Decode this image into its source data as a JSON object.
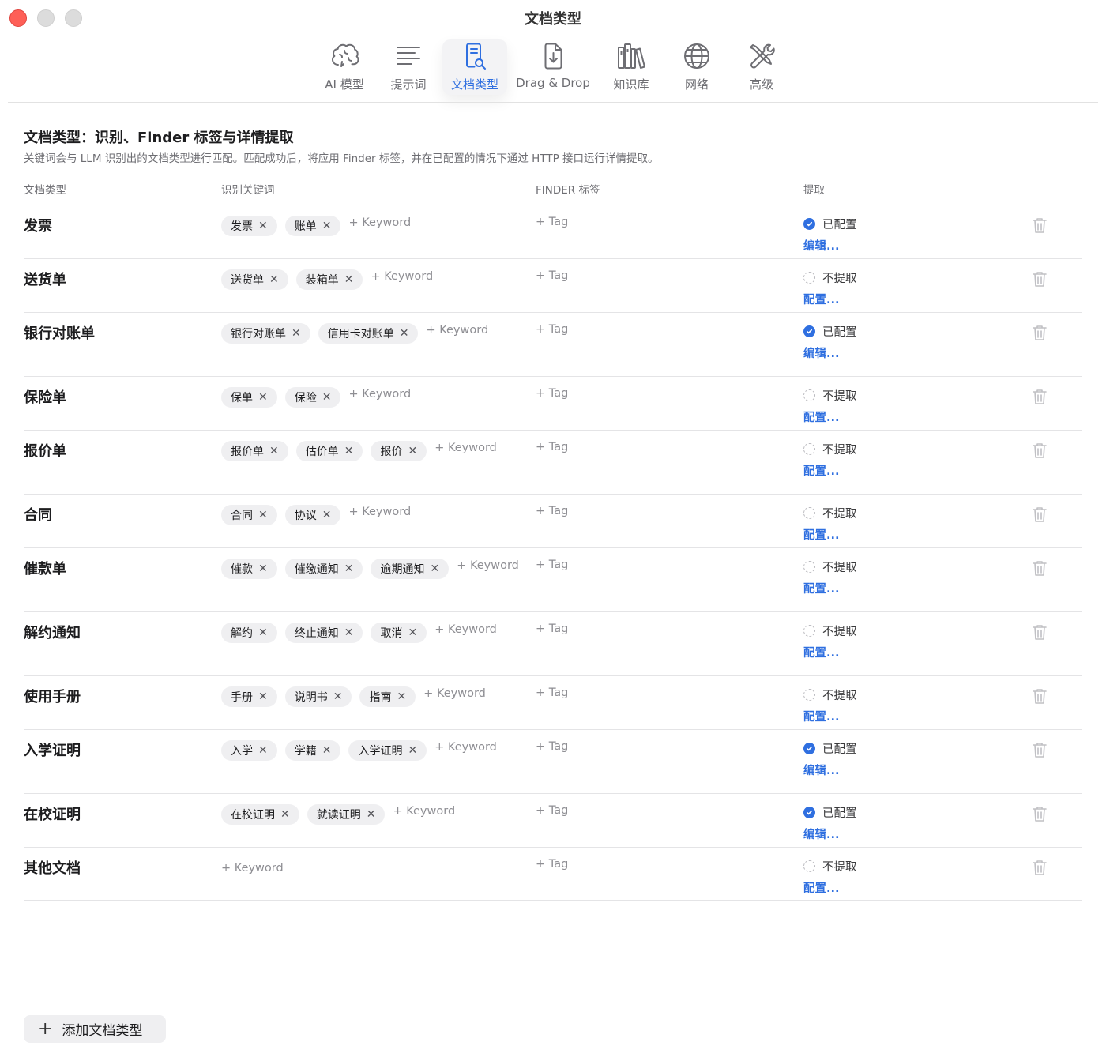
{
  "window": {
    "title": "文档类型"
  },
  "toolbar": [
    {
      "label": "AI 模型",
      "icon": "brain-icon"
    },
    {
      "label": "提示词",
      "icon": "text-lines-icon"
    },
    {
      "label": "文档类型",
      "icon": "document-search-icon",
      "active": true
    },
    {
      "label": "Drag & Drop",
      "icon": "document-download-icon"
    },
    {
      "label": "知识库",
      "icon": "books-icon"
    },
    {
      "label": "网络",
      "icon": "globe-icon"
    },
    {
      "label": "高级",
      "icon": "tools-icon"
    }
  ],
  "header": {
    "title": "文档类型：识别、Finder 标签与详情提取",
    "description": "关键词会与 LLM 识别出的文档类型进行匹配。匹配成功后，将应用 Finder 标签，并在已配置的情况下通过 HTTP 接口运行详情提取。"
  },
  "columns": {
    "type": "文档类型",
    "keywords": "识别关键词",
    "tags": "FINDER 标签",
    "extract": "提取"
  },
  "labels": {
    "add_keyword": "+ Keyword",
    "add_tag": "+ Tag",
    "configured": "已配置",
    "not_extract": "不提取",
    "edit": "编辑...",
    "configure": "配置...",
    "add_type": "添加文档类型"
  },
  "colors": {
    "accent": "#2f6fe0",
    "close": "#fe5f57",
    "chip_bg": "#efeff1"
  },
  "rows": [
    {
      "name": "发票",
      "keywords": [
        "发票",
        "账单"
      ],
      "configured": true
    },
    {
      "name": "送货单",
      "keywords": [
        "送货单",
        "装箱单"
      ],
      "configured": false
    },
    {
      "name": "银行对账单",
      "keywords": [
        "银行对账单",
        "信用卡对账单"
      ],
      "configured": true
    },
    {
      "name": "保险单",
      "keywords": [
        "保单",
        "保险"
      ],
      "configured": false
    },
    {
      "name": "报价单",
      "keywords": [
        "报价单",
        "估价单",
        "报价"
      ],
      "configured": false
    },
    {
      "name": "合同",
      "keywords": [
        "合同",
        "协议"
      ],
      "configured": false
    },
    {
      "name": "催款单",
      "keywords": [
        "催款",
        "催缴通知",
        "逾期通知"
      ],
      "configured": false
    },
    {
      "name": "解约通知",
      "keywords": [
        "解约",
        "终止通知",
        "取消"
      ],
      "configured": false
    },
    {
      "name": "使用手册",
      "keywords": [
        "手册",
        "说明书",
        "指南"
      ],
      "configured": false
    },
    {
      "name": "入学证明",
      "keywords": [
        "入学",
        "学籍",
        "入学证明"
      ],
      "configured": true
    },
    {
      "name": "在校证明",
      "keywords": [
        "在校证明",
        "就读证明"
      ],
      "configured": true
    },
    {
      "name": "其他文档",
      "keywords": [],
      "configured": false
    }
  ]
}
